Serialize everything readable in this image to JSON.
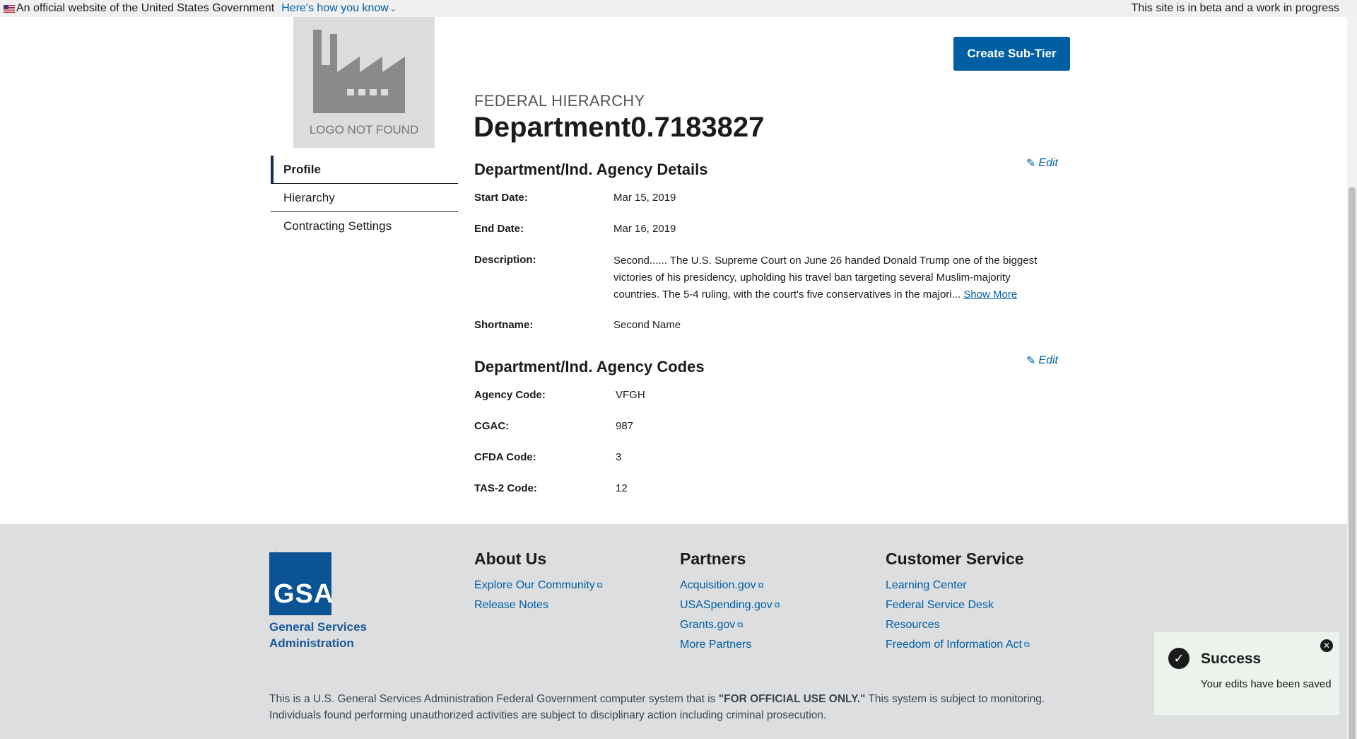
{
  "banner": {
    "official_text": "An official website of the United States Government",
    "how_you_know": "Here's how you know",
    "beta_text": "This site is in beta and a work in progress"
  },
  "logo": {
    "caption": "LOGO NOT FOUND"
  },
  "sidenav": {
    "items": [
      {
        "label": "Profile",
        "active": true
      },
      {
        "label": "Hierarchy"
      },
      {
        "label": "Contracting Settings"
      }
    ]
  },
  "header": {
    "create_button": "Create Sub-Tier",
    "eyebrow": "FEDERAL HIERARCHY",
    "title": "Department0.7183827"
  },
  "details": {
    "title": "Department/Ind. Agency Details",
    "edit": "Edit",
    "start_label": "Start Date:",
    "start_value": "Mar 15, 2019",
    "end_label": "End Date:",
    "end_value": "Mar 16, 2019",
    "desc_label": "Description:",
    "desc_value": "Second...... The U.S. Supreme Court on June 26 handed Donald Trump one of the biggest victories of his presidency, upholding his travel ban targeting several Muslim-majority countries. The 5-4 ruling, with the court's five conservatives in the majori...",
    "show_more": "Show More",
    "short_label": "Shortname:",
    "short_value": "Second Name"
  },
  "codes": {
    "title": "Department/Ind. Agency Codes",
    "edit": "Edit",
    "agency_label": "Agency Code:",
    "agency_value": "VFGH",
    "cgac_label": "CGAC:",
    "cgac_value": "987",
    "cfda_label": "CFDA Code:",
    "cfda_value": "3",
    "tas_label": "TAS-2 Code:",
    "tas_value": "12"
  },
  "footer": {
    "gsa_letters": "GSA",
    "gsa_name_1": "General Services",
    "gsa_name_2": "Administration",
    "about": {
      "title": "About Us",
      "links": [
        "Explore Our Community",
        "Release Notes"
      ]
    },
    "partners": {
      "title": "Partners",
      "links": [
        "Acquisition.gov",
        "USASpending.gov",
        "Grants.gov",
        "More Partners"
      ]
    },
    "service": {
      "title": "Customer Service",
      "links": [
        "Learning Center",
        "Federal Service Desk",
        "Resources",
        "Freedom of Information Act"
      ]
    },
    "disclaimer_pre": "This is a U.S. General Services Administration Federal Government computer system that is ",
    "disclaimer_bold": "\"FOR OFFICIAL USE ONLY.\"",
    "disclaimer_post": " This system is subject to monitoring. Individuals found performing unauthorized activities are subject to disciplinary action including criminal prosecution."
  },
  "toast": {
    "title": "Success",
    "message": "Your edits have been saved"
  },
  "colors": {
    "primary": "#005ea2",
    "navy": "#162e51",
    "footer_bg": "#dcdee0",
    "toast_bg": "#ecf3ec"
  }
}
